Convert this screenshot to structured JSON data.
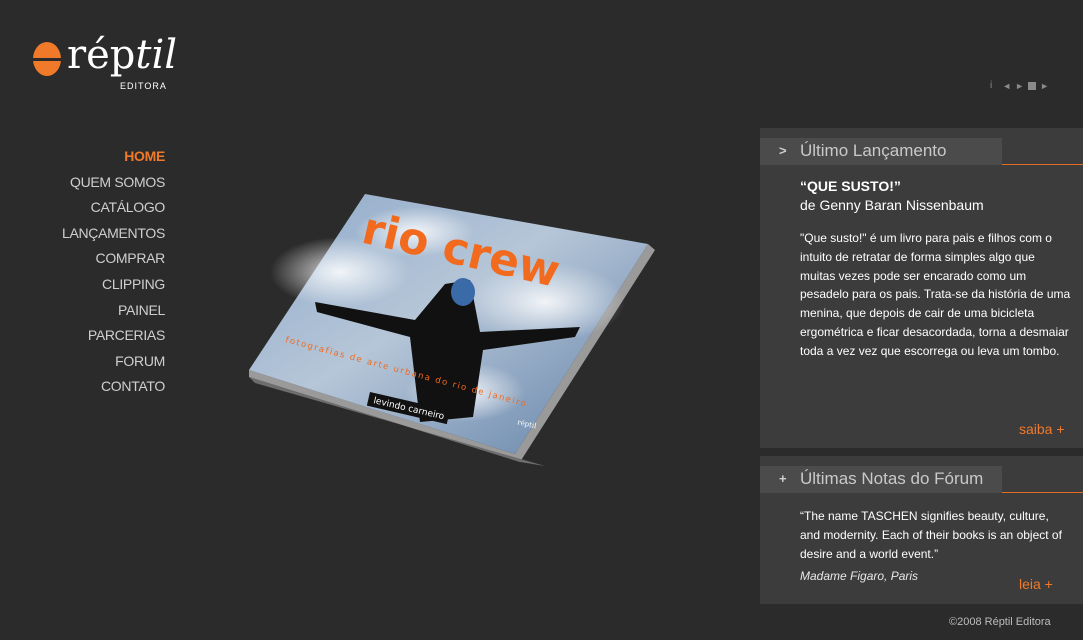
{
  "logo": {
    "word_plain": "rép",
    "word_italic": "til",
    "subtitle": "EDITORA"
  },
  "nav": [
    {
      "label": "HOME",
      "active": true
    },
    {
      "label": "QUEM SOMOS"
    },
    {
      "label": "CATÁLOGO"
    },
    {
      "label": "LANÇAMENTOS"
    },
    {
      "label": "COMPRAR"
    },
    {
      "label": "CLIPPING"
    },
    {
      "label": "PAINEL"
    },
    {
      "label": "PARCERIAS"
    },
    {
      "label": "FORUM"
    },
    {
      "label": "CONTATO"
    }
  ],
  "media_controls": {
    "info": "i",
    "prev": "◄",
    "play": "►",
    "next": "►"
  },
  "book_cover": {
    "title": "rio crew",
    "subtitle": "fotografias de arte urbana do rio de janeiro",
    "author": "levindo carneiro",
    "publisher_mark": "réptil"
  },
  "latest_release": {
    "icon": ">",
    "heading": "Último Lançamento",
    "book_title": "“QUE SUSTO!”",
    "author": "de Genny Baran Nissenbaum",
    "description": "\"Que susto!\" é um livro para pais e filhos com o intuito de retratar de forma simples algo que muitas vezes pode ser encarado como um pesadelo para os pais. Trata-se da história de uma menina, que depois de cair de uma bicicleta ergométrica e ficar desacordada, torna a desmaiar toda a vez vez que escorrega ou leva um tombo.",
    "more_label": "saiba +"
  },
  "forum_notes": {
    "icon": "+",
    "heading": "Últimas Notas do Fórum",
    "quote": "“The name TASCHEN signifies beauty, culture, and modernity. Each of their books is an object of desire and a world event.”",
    "source": "Madame Figaro, Paris",
    "more_label": "leia +"
  },
  "footer": {
    "copyright": "©2008 Réptil Editora"
  },
  "colors": {
    "accent": "#f07a2a",
    "background": "#2b2b2b",
    "panel": "#3c3c3c"
  }
}
